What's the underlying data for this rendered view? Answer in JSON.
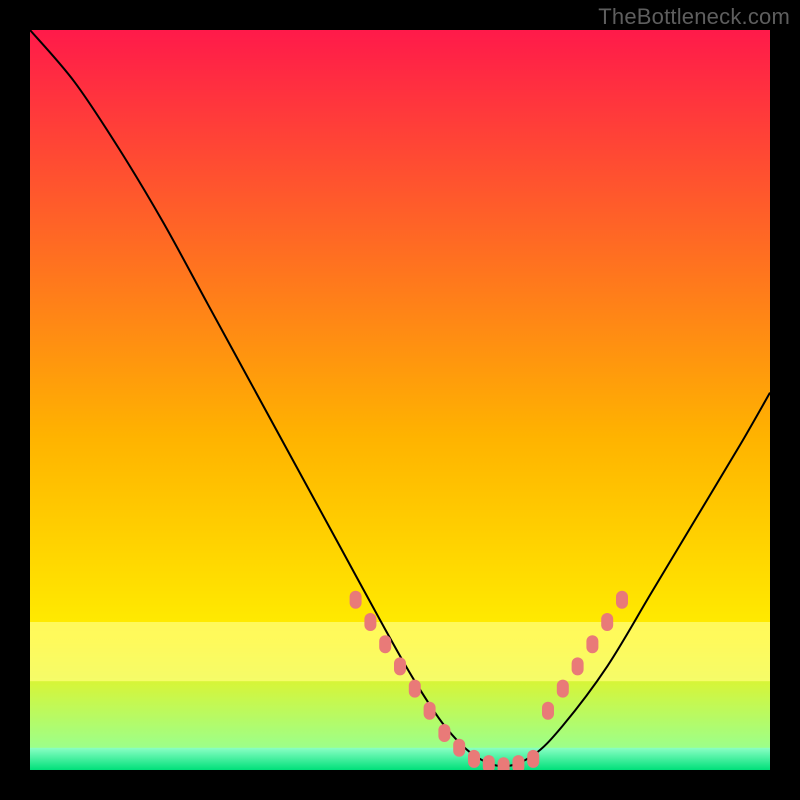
{
  "watermark": "TheBottleneck.com",
  "chart_data": {
    "type": "line",
    "title": "",
    "xlabel": "",
    "ylabel": "",
    "xlim": [
      0,
      100
    ],
    "ylim": [
      0,
      100
    ],
    "background_gradient": {
      "top": "#ff1a4a",
      "mid": "#ffb300",
      "yellow": "#ffee00",
      "green_light": "#9cff8a",
      "green": "#00e07a"
    },
    "series": [
      {
        "name": "bottleneck-curve",
        "color": "#000000",
        "x": [
          0,
          6,
          12,
          18,
          24,
          30,
          36,
          42,
          48,
          52,
          56,
          60,
          64,
          68,
          72,
          78,
          84,
          90,
          96,
          100
        ],
        "y": [
          100,
          93,
          84,
          74,
          63,
          52,
          41,
          30,
          19,
          12,
          6,
          2,
          0.5,
          2,
          6,
          14,
          24,
          34,
          44,
          51
        ]
      },
      {
        "name": "highlight-left-dots",
        "color": "#e97a78",
        "marker": "dot",
        "x": [
          44,
          46,
          48,
          50,
          52,
          54,
          56,
          58,
          60,
          62,
          64,
          66,
          68
        ],
        "y": [
          23,
          20,
          17,
          14,
          11,
          8,
          5,
          3,
          1.5,
          0.8,
          0.5,
          0.8,
          1.5
        ]
      },
      {
        "name": "highlight-right-dots",
        "color": "#e97a78",
        "marker": "dot",
        "x": [
          70,
          72,
          74,
          76,
          78,
          80
        ],
        "y": [
          8,
          11,
          14,
          17,
          20,
          23
        ]
      }
    ],
    "yellow_band": {
      "y_from": 12,
      "y_to": 20,
      "color": "#fffd7a"
    },
    "green_band": {
      "y_from": 0,
      "y_to": 3,
      "color_top": "#8affc4",
      "color_bottom": "#00e07a"
    }
  }
}
